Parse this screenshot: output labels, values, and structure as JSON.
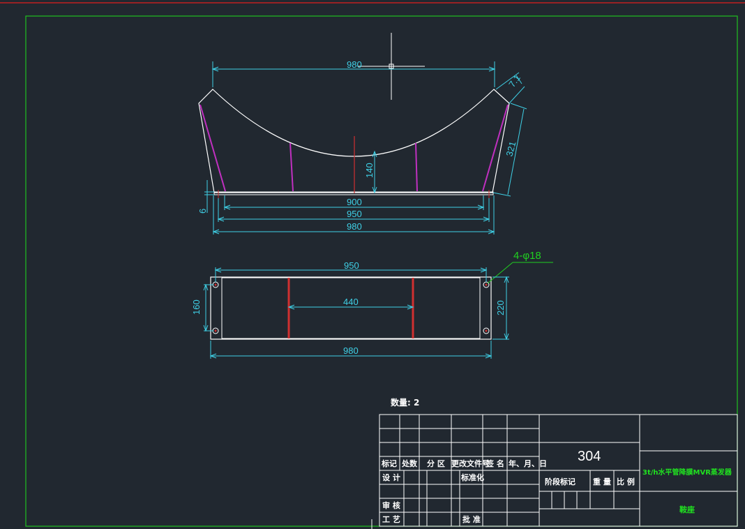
{
  "drawing": {
    "front_view": {
      "dim_top": "980",
      "dim_angle_small": "7.1",
      "dim_slope": "321",
      "dim_height": "140",
      "dim_plate": "6",
      "dim_900": "900",
      "dim_950": "950",
      "dim_980": "980"
    },
    "plan_view": {
      "dim_top": "950",
      "dim_mid": "440",
      "dim_left": "160",
      "dim_right": "220",
      "dim_bottom": "980",
      "hole_callout": "4-φ18"
    },
    "quantity_label": "数量: 2"
  },
  "title_block": {
    "row_headers": [
      "标记",
      "处数",
      "分 区",
      "更改文件号",
      "签 名",
      "年、月、日"
    ],
    "design": "设 计",
    "standardize": "标准化",
    "review": "审 核",
    "process": "工 艺",
    "approve": "批 准",
    "material": "304",
    "stage_mark": "阶段标记",
    "weight": "重 量",
    "scale": "比 例",
    "project_title": "3t/h水平管降膜MVR蒸发器",
    "part_name": "鞍座"
  },
  "colors": {
    "background": "#212830",
    "border": "#20c020",
    "dimension": "#3fd0e6",
    "outline": "#ffffff",
    "centerline": "#d03030",
    "hidden": "#c030c0",
    "callout": "#20d020"
  }
}
